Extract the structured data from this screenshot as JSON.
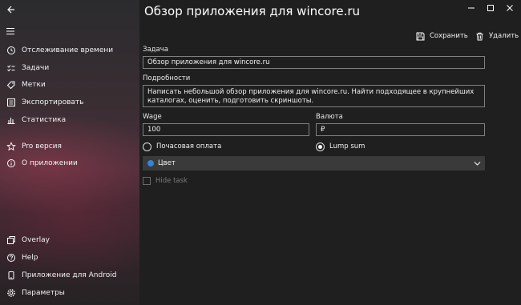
{
  "window": {
    "title": "Обзор приложения для wincore.ru"
  },
  "sidebar": {
    "items": [
      {
        "label": "Отслеживание времени",
        "icon": "clock-icon"
      },
      {
        "label": "Задачи",
        "icon": "tasks-icon"
      },
      {
        "label": "Метки",
        "icon": "tag-icon"
      },
      {
        "label": "Экспортировать",
        "icon": "export-icon"
      },
      {
        "label": "Статистика",
        "icon": "statistics-icon"
      },
      {
        "label": "Pro версия",
        "icon": "star-icon"
      },
      {
        "label": "О приложении",
        "icon": "info-icon"
      },
      {
        "label": "Overlay",
        "icon": "overlay-icon"
      },
      {
        "label": "Help",
        "icon": "help-icon"
      },
      {
        "label": "Приложение для Android",
        "icon": "android-icon"
      },
      {
        "label": "Параметры",
        "icon": "gear-icon"
      }
    ]
  },
  "toolbar": {
    "save_label": "Сохранить",
    "delete_label": "Удалить"
  },
  "form": {
    "task_label": "Задача",
    "task_value": "Обзор приложения для wincore.ru",
    "details_label": "Подробности",
    "details_value": "Написать небольшой обзор приложения для wincore.ru.  Найти подходящее в крупнейших каталогах, оценить, подготовить скриншоты.",
    "wage_label": "Wage",
    "wage_value": "100",
    "currency_label": "Валюта",
    "currency_value": "₽",
    "hourly_label": "Почасовая оплата",
    "lump_label": "Lump sum",
    "selected_rate": "Lump sum",
    "color_label": "Цвет",
    "color_value": "#2e86de",
    "hide_task_label": "Hide task",
    "hide_task_checked": false
  }
}
